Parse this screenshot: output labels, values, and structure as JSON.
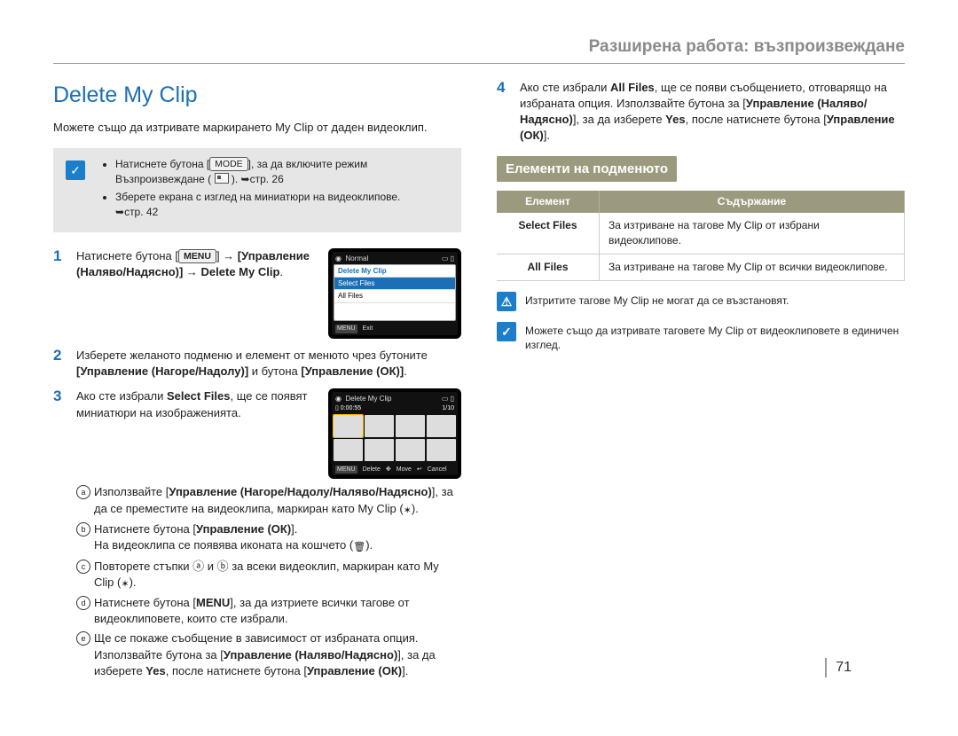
{
  "header": "Разширена работа: възпроизвеждане",
  "title": "Delete My Clip",
  "intro": "Можете също да изтривате маркирането My Clip от даден видеоклип.",
  "note": {
    "bullets": [
      {
        "pre": "Натиснете бутона [",
        "kbd": "MODE",
        "post": "], за да включите режим Възпроизвеждане ( ",
        "pageref": "стр. 26"
      },
      {
        "text": "Зберете екрана с изглед на миниатюри на видеоклипове.",
        "pageref": "стр. 42"
      }
    ]
  },
  "steps": [
    {
      "num": "1",
      "text_pre": "Натиснете бутона [",
      "kbd": "MENU",
      "text_post": "] → [Управление (Наляво/Надясно)] → Delete My Clip.",
      "lcd": {
        "top": "Normal",
        "rows": [
          "Delete My Clip",
          "Select Files",
          "All Files"
        ],
        "selected": 1,
        "exit": "Exit",
        "exit_tag": "MENU"
      }
    },
    {
      "num": "2",
      "text": "Изберете желаното подменю и елемент от менюто чрез бутоните [Управление (Нагоре/Надолу)] и бутона [Управление (ОК)]."
    },
    {
      "num": "3",
      "text_pre": "Ако сте избрали ",
      "bold": "Select Files",
      "text_post": ", ще се появят миниатюри на изображенията.",
      "lcd": {
        "title": "Delete My Clip",
        "time": "0:00:55",
        "counter": "1/10",
        "bottom": [
          {
            "tag": "MENU",
            "label": "Delete"
          },
          {
            "tag": "",
            "label": "Move"
          },
          {
            "tag": "",
            "label": "Cancel"
          }
        ]
      },
      "sub": [
        {
          "m": "a",
          "html": "Използвайте [<b>Управление (Нагоре/Надолу/Наляво/Надясно)</b>], за да се преместите на видеоклипа, маркиран като My Clip (",
          "tail": ")."
        },
        {
          "m": "b",
          "html": "Натиснете бутона [<b>Управление (ОК)</b>]. На видеоклипа се появява иконата на кошчето (",
          "tail": ")."
        },
        {
          "m": "c",
          "html": "Повторете стъпки ⓐ и ⓑ за всеки видеоклип, маркиран като My Clip (",
          "tail": ")."
        },
        {
          "m": "d",
          "html": "Натиснете бутона [<b>MENU</b>], за да изтриете всички тагове от видеоклиповете, които сте избрали."
        },
        {
          "m": "e",
          "html": "Ще се покаже съобщение в зависимост от избраната опция. Използвайте бутона за [<b>Управление (Наляво/Надясно)</b>], за да изберете <b>Yes</b>, после натиснете бутона [<b>Управление (ОК)</b>]."
        }
      ]
    }
  ],
  "right_step": {
    "num": "4",
    "text": "Ако сте избрали <b>All Files</b>, ще се появи съобщението, отговарящо на избраната опция. Използвайте бутона за [<b>Управление (Наляво/Надясно)</b>], за да изберете <b>Yes</b>, после натиснете бутона [<b>Управление (ОК)</b>]."
  },
  "subhead": "Елементи на подменюто",
  "table": {
    "headers": [
      "Елемент",
      "Съдържание"
    ],
    "rows": [
      {
        "k": "Select Files",
        "v": "За изтриване на тагове My Clip от избрани видеоклипове."
      },
      {
        "k": "All Files",
        "v": "За изтриване на тагове My Clip от всички видеоклипове."
      }
    ]
  },
  "warn": "Изтритите тагове My Clip не могат да се възстановят.",
  "tip": "Можете също да изтривате таговете My Clip от видеоклиповете в единичен изглед.",
  "page": "71"
}
